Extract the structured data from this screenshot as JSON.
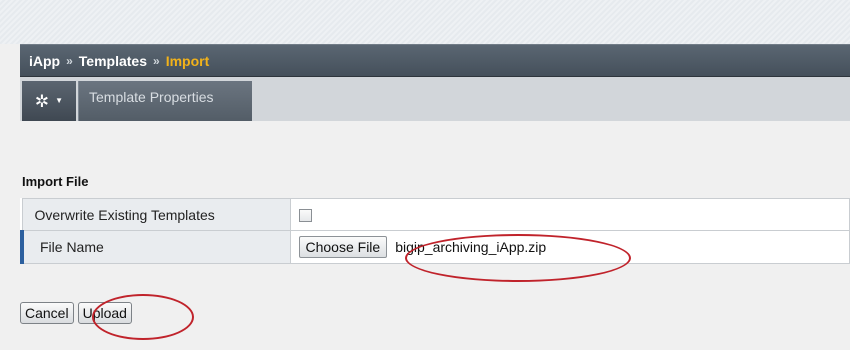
{
  "breadcrumb": {
    "items": [
      "iApp",
      "Templates"
    ],
    "separator": "»",
    "current": "Import"
  },
  "toolbar": {
    "menu_icon": "gear-icon",
    "tabs": [
      {
        "label": "Template Properties"
      }
    ]
  },
  "section": {
    "title": "Import File"
  },
  "form": {
    "overwrite": {
      "label": "Overwrite Existing Templates",
      "checked": false
    },
    "file": {
      "label": "File Name",
      "button_label": "Choose File",
      "value": "bigip_archiving_iApp.zip"
    }
  },
  "actions": {
    "cancel_label": "Cancel",
    "upload_label": "Upload"
  },
  "colors": {
    "header": "#4e5964",
    "current_crumb": "#f2b21a",
    "required_marker": "#2c5f9e",
    "callout": "#c0232b"
  }
}
